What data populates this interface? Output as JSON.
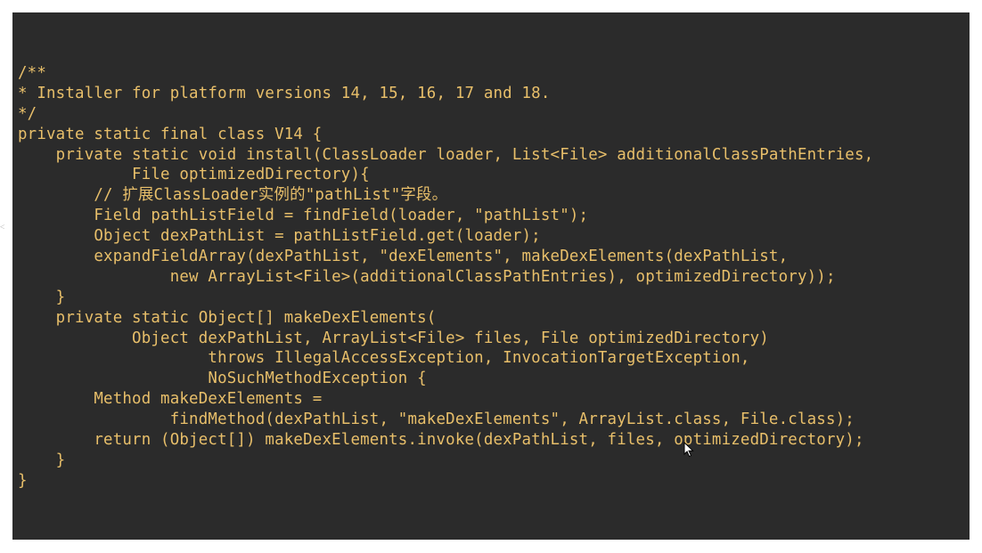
{
  "editor": {
    "lines": [
      "/**",
      "* Installer for platform versions 14, 15, 16, 17 and 18.",
      "*/",
      "private static final class V14 {",
      "    private static void install(ClassLoader loader, List<File> additionalClassPathEntries,",
      "            File optimizedDirectory){",
      "        // 扩展ClassLoader实例的\"pathList\"字段。",
      "        Field pathListField = findField(loader, \"pathList\");",
      "        Object dexPathList = pathListField.get(loader);",
      "        expandFieldArray(dexPathList, \"dexElements\", makeDexElements(dexPathList,",
      "                new ArrayList<File>(additionalClassPathEntries), optimizedDirectory));",
      "    }",
      "    private static Object[] makeDexElements(",
      "            Object dexPathList, ArrayList<File> files, File optimizedDirectory)",
      "                    throws IllegalAccessException, InvocationTargetException,",
      "                    NoSuchMethodException {",
      "        Method makeDexElements =",
      "                findMethod(dexPathList, \"makeDexElements\", ArrayList.class, File.class);",
      "        return (Object[]) makeDexElements.invoke(dexPathList, files, optimizedDirectory);",
      "    }",
      "}"
    ]
  },
  "colors": {
    "background": "#2b2b2b",
    "code_text": "#e8bf6a",
    "page": "#ffffff"
  },
  "icons": {
    "cursor": "mouse-pointer-icon"
  }
}
